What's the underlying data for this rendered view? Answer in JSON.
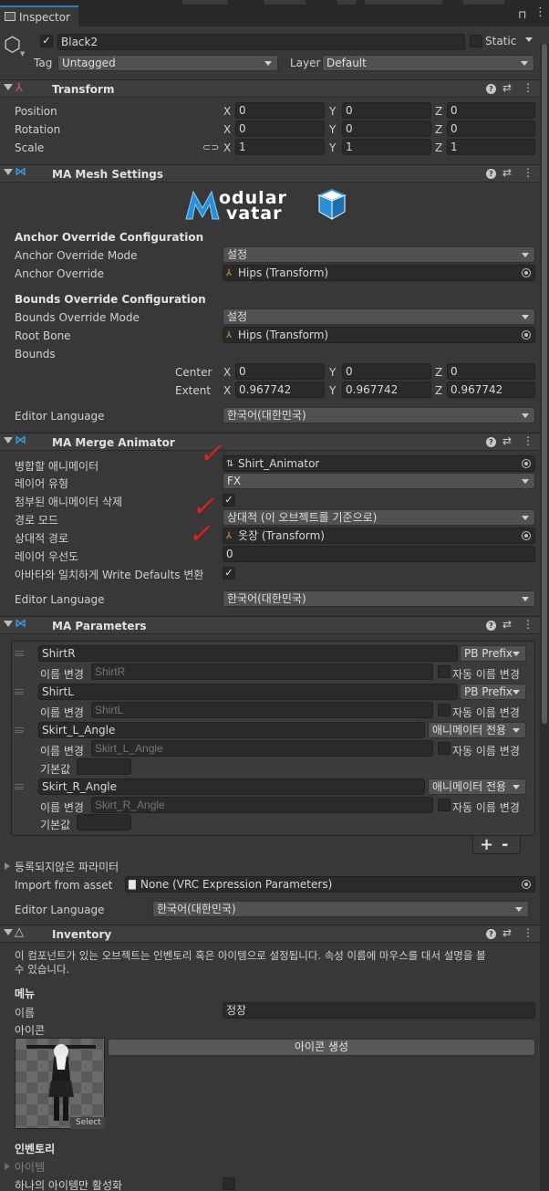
{
  "window": {
    "tab_title": "Inspector",
    "tab_icon": "inspector-icon"
  },
  "object": {
    "name": "Black2",
    "active": true,
    "static_label": "Static",
    "static_checked": false,
    "tag_label": "Tag",
    "tag_value": "Untagged",
    "layer_label": "Layer",
    "layer_value": "Default"
  },
  "transform": {
    "title": "Transform",
    "position_label": "Position",
    "rotation_label": "Rotation",
    "scale_label": "Scale",
    "axis": {
      "x": "X",
      "y": "Y",
      "z": "Z"
    },
    "position": [
      "0",
      "0",
      "0"
    ],
    "rotation": [
      "0",
      "0",
      "0"
    ],
    "scale": [
      "1",
      "1",
      "1"
    ]
  },
  "mesh_settings": {
    "title": "MA Mesh Settings",
    "logo_line1": "odular",
    "logo_line2": "vatar",
    "anchor_header": "Anchor Override Configuration",
    "anchor_mode_label": "Anchor Override Mode",
    "anchor_mode_value": "설정",
    "anchor_override_label": "Anchor Override",
    "anchor_override_value": "Hips (Transform)",
    "bounds_header": "Bounds Override Configuration",
    "bounds_mode_label": "Bounds Override Mode",
    "bounds_mode_value": "설정",
    "root_bone_label": "Root Bone",
    "root_bone_value": "Hips (Transform)",
    "bounds_label": "Bounds",
    "center_label": "Center",
    "center": [
      "0",
      "0",
      "0"
    ],
    "extent_label": "Extent",
    "extent": [
      "0.967742",
      "0.967742",
      "0.967742"
    ],
    "lang_label": "Editor Language",
    "lang_value": "한국어(대한민국)"
  },
  "merge_animator": {
    "title": "MA Merge Animator",
    "animator_label": "병합할 애니메이터",
    "animator_value": "Shirt_Animator",
    "layer_type_label": "레이어 유형",
    "layer_type_value": "FX",
    "delete_label": "첨부된 애니메이터 삭제",
    "delete_checked": true,
    "path_mode_label": "경로 모드",
    "path_mode_value": "상대적 (이 오브젝트를 기준으로)",
    "rel_path_label": "상대적 경로",
    "rel_path_value": "옷장 (Transform)",
    "priority_label": "레이어 우선도",
    "priority_value": "0",
    "wd_label": "아바타와 일치하게 Write Defaults 변환",
    "wd_checked": true,
    "lang_label": "Editor Language",
    "lang_value": "한국어(대한민국)",
    "mark_char": "✓"
  },
  "parameters": {
    "title": "MA Parameters",
    "rename_label": "이름 변경",
    "auto_rename_label": "자동 이름 변경",
    "default_label": "기본값",
    "items": [
      {
        "name": "ShirtR",
        "type": "PB Prefix",
        "placeholder": "ShirtR"
      },
      {
        "name": "ShirtL",
        "type": "PB Prefix",
        "placeholder": "ShirtL"
      },
      {
        "name": "Skirt_L_Angle",
        "type": "애니메이터 전용",
        "placeholder": "Skirt_L_Angle"
      },
      {
        "name": "Skirt_R_Angle",
        "type": "애니메이터 전용",
        "placeholder": "Skirt_R_Angle"
      }
    ],
    "add_label": "+",
    "remove_label": "-",
    "unregistered_label": "등록되지않은 파라미터",
    "import_label": "Import from asset",
    "import_value": "None (VRC Expression Parameters)",
    "lang_label": "Editor Language",
    "lang_value": "한국어(대한민국)"
  },
  "inventory": {
    "title": "Inventory",
    "description_line1": "이 컴포넌트가 있는 오브젝트는 인벤토리 혹은 아이템으로 설정됩니다. 속성 이름에 마우스를 대서 설명을 볼",
    "description_line2": "수 있습니다.",
    "menu_header": "메뉴",
    "name_label": "이름",
    "name_value": "정장",
    "icon_label": "아이콘",
    "icon_button": "아이콘 생성",
    "select_label": "Select",
    "inventory_header": "인벤토리",
    "items_label": "아이템",
    "single_label": "하나의 아이템만 활성화"
  }
}
